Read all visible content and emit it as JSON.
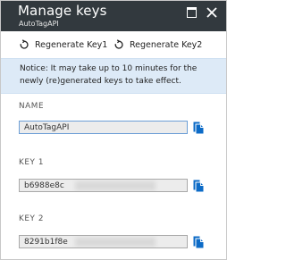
{
  "blade": {
    "title": "Manage keys",
    "subtitle": "AutoTagAPI"
  },
  "toolbar": {
    "regenerate_key1_label": "Regenerate Key1",
    "regenerate_key2_label": "Regenerate Key2"
  },
  "notice": {
    "text": "Notice: It may take up to 10 minutes for the newly (re)generated keys to take effect."
  },
  "fields": {
    "name": {
      "label": "NAME",
      "value": "AutoTagAPI"
    },
    "key1": {
      "label": "KEY 1",
      "value": "b6988e8c"
    },
    "key2": {
      "label": "KEY 2",
      "value": "8291b1f8e"
    }
  },
  "colors": {
    "header_bg": "#32393e",
    "notice_bg": "#ddeaf7",
    "copy_icon_blue": "#0c6bc7"
  },
  "icons": {
    "maximize": "maximize-icon",
    "close": "close-icon",
    "regenerate": "refresh-icon",
    "copy": "copy-icon"
  }
}
